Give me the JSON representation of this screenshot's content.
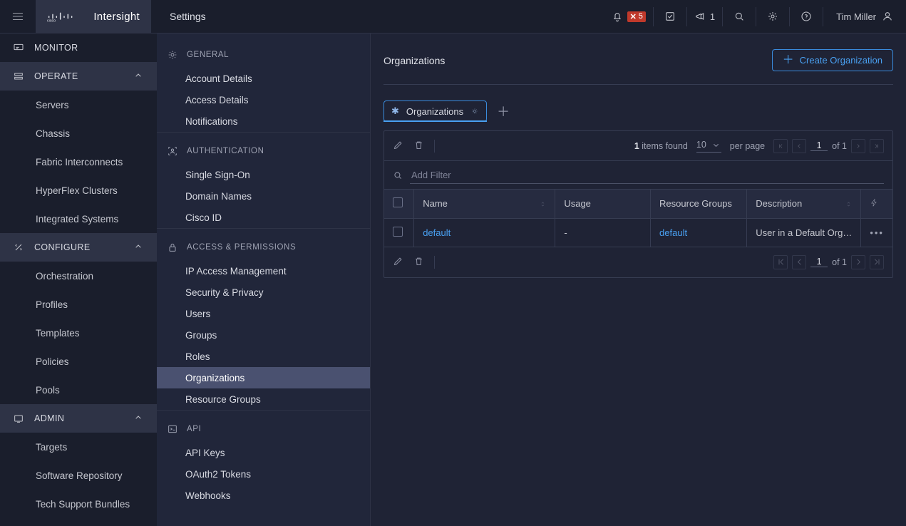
{
  "brand": {
    "name": "Intersight",
    "vendor": "cisco"
  },
  "top": {
    "title": "Settings",
    "alarm_count": "5",
    "announce_count": "1",
    "user": "Tim Miller"
  },
  "nav1": {
    "monitor": "MONITOR",
    "operate": {
      "label": "OPERATE",
      "items": [
        "Servers",
        "Chassis",
        "Fabric Interconnects",
        "HyperFlex Clusters",
        "Integrated Systems"
      ]
    },
    "configure": {
      "label": "CONFIGURE",
      "items": [
        "Orchestration",
        "Profiles",
        "Templates",
        "Policies",
        "Pools"
      ]
    },
    "admin": {
      "label": "ADMIN",
      "items": [
        "Targets",
        "Software Repository",
        "Tech Support Bundles"
      ]
    }
  },
  "nav2": {
    "general": {
      "label": "GENERAL",
      "items": [
        "Account Details",
        "Access Details",
        "Notifications"
      ]
    },
    "auth": {
      "label": "AUTHENTICATION",
      "items": [
        "Single Sign-On",
        "Domain Names",
        "Cisco ID"
      ]
    },
    "access": {
      "label": "ACCESS & PERMISSIONS",
      "items": [
        "IP Access Management",
        "Security & Privacy",
        "Users",
        "Groups",
        "Roles",
        "Organizations",
        "Resource Groups"
      ],
      "active_index": 5
    },
    "api": {
      "label": "API",
      "items": [
        "API Keys",
        "OAuth2 Tokens",
        "Webhooks"
      ]
    }
  },
  "main": {
    "title": "Organizations",
    "create_label": "Create Organization",
    "tab_label": "Organizations",
    "items_found_count": "1",
    "items_found_label": "items found",
    "per_page_value": "10",
    "per_page_label": "per page",
    "page_current": "1",
    "page_total_label": "of 1",
    "filter_placeholder": "Add Filter",
    "columns": {
      "name": "Name",
      "usage": "Usage",
      "rg": "Resource Groups",
      "desc": "Description"
    },
    "row": {
      "name": "default",
      "usage": "-",
      "rg": "default",
      "desc": "User in a Default Org…"
    }
  }
}
